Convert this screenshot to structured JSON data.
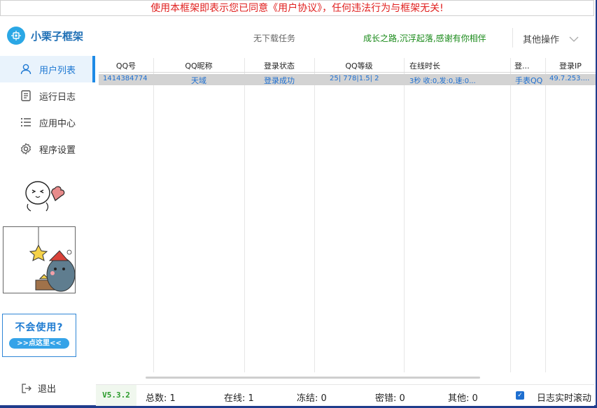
{
  "notice": "使用本框架即表示您已同意《用户协议》，任何违法行为与框架无关!",
  "app": {
    "name": "小栗子框架"
  },
  "nav": [
    {
      "label": "用户列表",
      "icon": "user-icon",
      "active": true
    },
    {
      "label": "运行日志",
      "icon": "log-icon",
      "active": false
    },
    {
      "label": "应用中心",
      "icon": "list-icon",
      "active": false
    },
    {
      "label": "程序设置",
      "icon": "gear-icon",
      "active": false
    }
  ],
  "help": {
    "title": "不会使用?",
    "button": ">>点这里<<"
  },
  "logout": "退出",
  "topbar": {
    "task": "无下载任务",
    "motto": "成长之路,沉浮起落,感谢有你相伴",
    "other": "其他操作"
  },
  "table": {
    "headers": [
      "QQ号",
      "QQ昵称",
      "登录状态",
      "QQ等级",
      "在线时长",
      "登...",
      "登录IP"
    ],
    "rows": [
      [
        "1414384774",
        "天域",
        "登录成功",
        "25| 778|1.5| 2",
        "3秒 收:0,发:0,速:0...",
        "手表QQ",
        "49.7.253...."
      ]
    ]
  },
  "status": {
    "version": "V5.3.2",
    "total": "总数: 1",
    "online": "在线: 1",
    "frozen": "冻结: 0",
    "pwd_error": "密错: 0",
    "other": "其他: 0",
    "log_scroll_label": "日志实时滚动",
    "log_scroll_checked": true
  },
  "colors": {
    "accent": "#1e78d2",
    "notice": "#e0201f",
    "motto": "#1a8a1a",
    "frame": "#1f3c8c"
  }
}
